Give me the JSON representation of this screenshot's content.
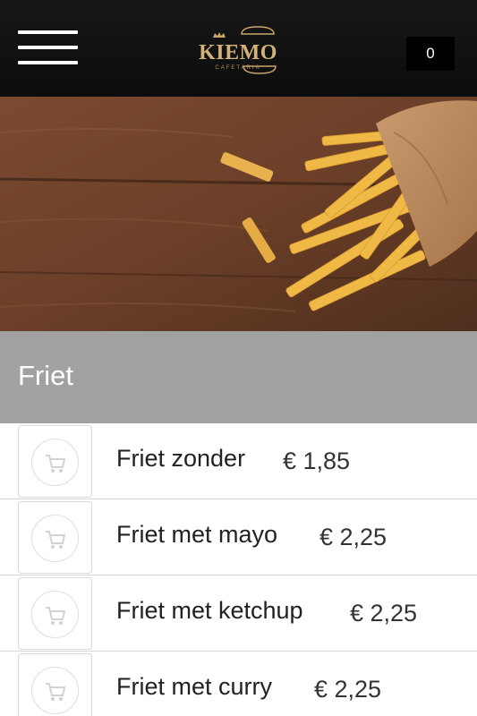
{
  "header": {
    "brand": "KIEMO",
    "brand_sub": "CAFETARIA",
    "cart_count": "0"
  },
  "category": {
    "title": "Friet"
  },
  "products": [
    {
      "name": "Friet zonder",
      "price": "€ 1,85"
    },
    {
      "name": "Friet met mayo",
      "price": "€ 2,25"
    },
    {
      "name": "Friet met ketchup",
      "price": "€ 2,25"
    },
    {
      "name": "Friet met curry",
      "price": "€ 2,25"
    }
  ],
  "colors": {
    "header_bg": "#111111",
    "logo_gold": "#d3b27a",
    "category_bg": "#a1a1a1",
    "text_dark": "#222222"
  }
}
